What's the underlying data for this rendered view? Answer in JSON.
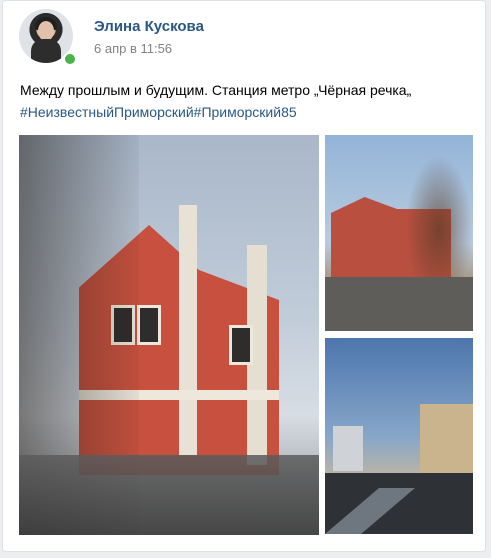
{
  "post": {
    "author": "Элина Кускова",
    "date": "6 апр в 11:56",
    "text": "Между прошлым и будущим. Станция метро „Чёрная речка„",
    "hashtags": [
      "#НеизвестныйПриморский",
      "#Приморский85"
    ]
  },
  "photos": [
    {
      "alt": "photo-1"
    },
    {
      "alt": "photo-2"
    },
    {
      "alt": "photo-3"
    }
  ],
  "colors": {
    "link": "#2a5885",
    "muted": "#828282",
    "online": "#4bb34b"
  }
}
